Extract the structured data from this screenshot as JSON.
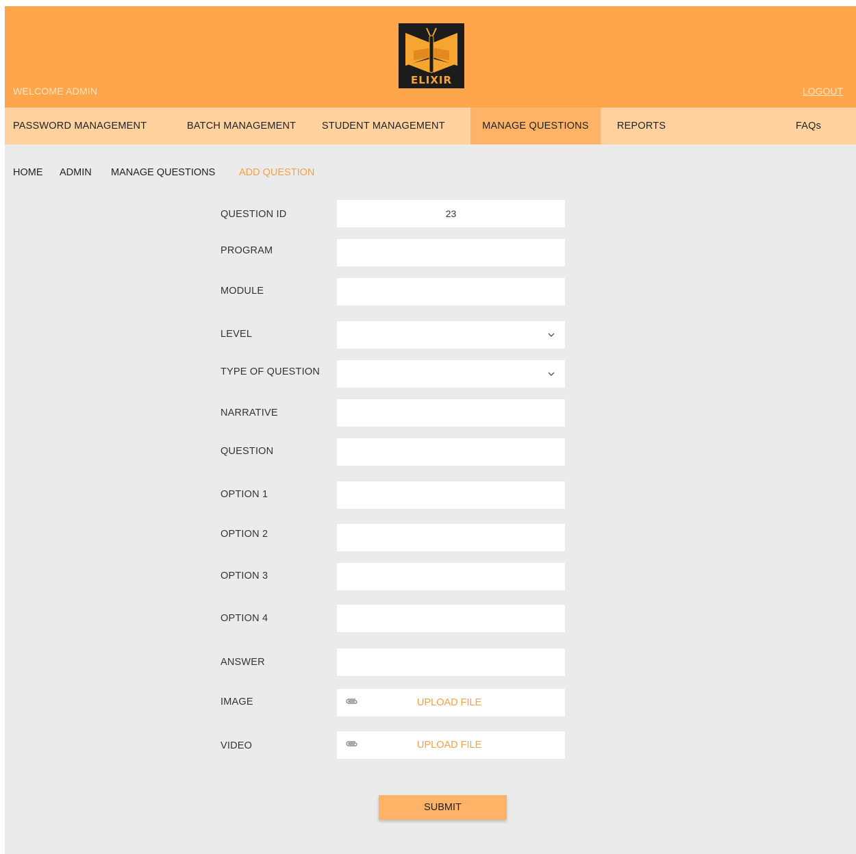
{
  "header": {
    "welcome_text": "WELCOME ADMIN",
    "logout_label": "LOGOUT",
    "logo_text": "ELIXIR",
    "colors": {
      "header_bg": "#ffa54b",
      "nav_bg": "#ffd2a0",
      "nav_active_bg": "#ffb367",
      "accent": "#f7a043",
      "page_bg": "#ebebeb"
    }
  },
  "nav": {
    "items": [
      {
        "label": "PASSWORD MANAGEMENT"
      },
      {
        "label": "BATCH MANAGEMENT"
      },
      {
        "label": "STUDENT MANAGEMENT"
      },
      {
        "label": "MANAGE QUESTIONS",
        "active": true
      },
      {
        "label": "REPORTS"
      },
      {
        "label": "FAQs"
      }
    ]
  },
  "breadcrumb": {
    "items": [
      "HOME",
      "ADMIN",
      "MANAGE QUESTIONS",
      "ADD QUESTION"
    ]
  },
  "form": {
    "question_id": {
      "label": "QUESTION ID",
      "value": "23"
    },
    "program": {
      "label": "PROGRAM",
      "value": ""
    },
    "module": {
      "label": "MODULE",
      "value": ""
    },
    "level": {
      "label": "LEVEL",
      "value": "",
      "icon": "chevron-down-icon"
    },
    "type_of_question": {
      "label": "TYPE OF QUESTION",
      "value": "",
      "icon": "chevron-down-icon"
    },
    "narrative": {
      "label": "NARRATIVE",
      "value": ""
    },
    "question": {
      "label": "QUESTION",
      "value": ""
    },
    "option1": {
      "label": "OPTION 1",
      "value": ""
    },
    "option2": {
      "label": "OPTION 2",
      "value": ""
    },
    "option3": {
      "label": "OPTION 3",
      "value": ""
    },
    "option4": {
      "label": "OPTION 4",
      "value": ""
    },
    "answer": {
      "label": "ANSWER",
      "value": ""
    },
    "image": {
      "label": "IMAGE",
      "upload_label": "UPLOAD FILE",
      "icon": "paperclip-icon"
    },
    "video": {
      "label": "VIDEO",
      "upload_label": "UPLOAD FILE",
      "icon": "paperclip-icon"
    },
    "submit_label": "SUBMIT"
  }
}
